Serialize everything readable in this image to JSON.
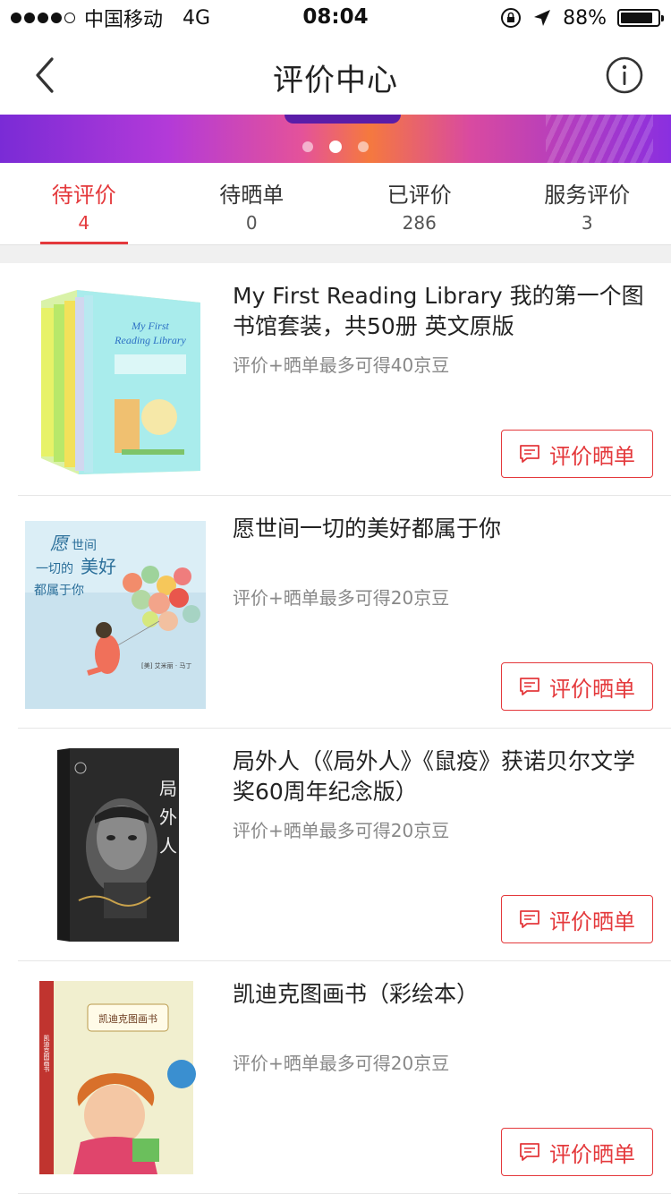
{
  "status_bar": {
    "carrier": "中国移动",
    "network": "4G",
    "time": "08:04",
    "battery": "88%",
    "battery_level": 0.88
  },
  "nav": {
    "title": "评价中心"
  },
  "tabs": [
    {
      "label": "待评价",
      "count": "4",
      "active": true
    },
    {
      "label": "待晒单",
      "count": "0",
      "active": false
    },
    {
      "label": "已评价",
      "count": "286",
      "active": false
    },
    {
      "label": "服务评价",
      "count": "3",
      "active": false
    }
  ],
  "products": [
    {
      "title": "My First Reading Library  我的第一个图书馆套装，共50册 英文原版",
      "subtitle": "评价+晒单最多可得40京豆",
      "button": "评价晒单",
      "cover": "boxed-set"
    },
    {
      "title": "愿世间一切的美好都属于你",
      "subtitle": "评价+晒单最多可得20京豆",
      "button": "评价晒单",
      "cover": "balloons"
    },
    {
      "title": "局外人（《局外人》《鼠疫》获诺贝尔文学奖60周年纪念版）",
      "subtitle": "评价+晒单最多可得20京豆",
      "button": "评价晒单",
      "cover": "dark-portrait"
    },
    {
      "title": "凯迪克图画书（彩绘本）",
      "subtitle": "评价+晒单最多可得20京豆",
      "button": "评价晒单",
      "cover": "picture-book"
    }
  ],
  "colors": {
    "accent": "#e4393c",
    "subtitle": "#888888",
    "divider": "#e6e6e6"
  },
  "icons": [
    "back-arrow-icon",
    "info-icon",
    "location-arrow-icon",
    "orientation-lock-icon",
    "battery-icon",
    "comment-icon"
  ]
}
